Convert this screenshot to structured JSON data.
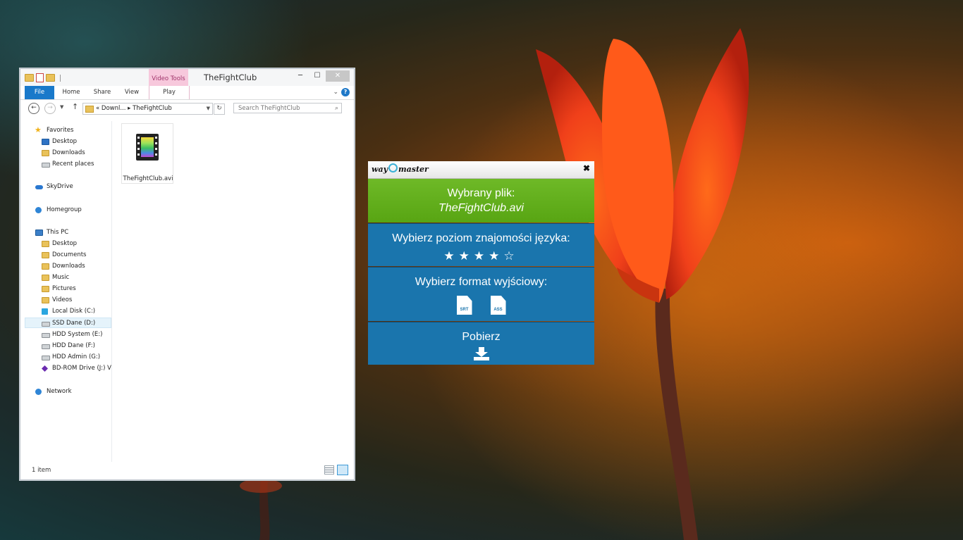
{
  "explorer": {
    "title": "TheFightClub",
    "contextual_tab": "Video Tools",
    "tabs": {
      "file": "File",
      "home": "Home",
      "share": "Share",
      "view": "View",
      "play": "Play"
    },
    "address": "«  Downl...  ▸  TheFightClub",
    "search_placeholder": "Search TheFightClub",
    "nav": {
      "favorites": "Favorites",
      "desktop": "Desktop",
      "downloads": "Downloads",
      "recent": "Recent places",
      "skydrive": "SkyDrive",
      "homegroup": "Homegroup",
      "this_pc": "This PC",
      "pc_desktop": "Desktop",
      "documents": "Documents",
      "pc_downloads": "Downloads",
      "music": "Music",
      "pictures": "Pictures",
      "videos": "Videos",
      "local_disk": "Local Disk (C:)",
      "ssd": "SSD Dane (D:)",
      "hdd_system": "HDD System (E:)",
      "hdd_dane": "HDD Dane (F:)",
      "hdd_admin": "HDD Admin (G:)",
      "bd_rom": "BD-ROM Drive (J:) V",
      "network": "Network"
    },
    "file_name": "TheFightClub.avi",
    "status": "1 item"
  },
  "waymaster": {
    "logo_left": "way",
    "logo_right": "master",
    "close": "✖",
    "selected_file_label": "Wybrany plik:",
    "selected_file": "TheFightClub.avi",
    "lang_label": "Wybierz poziom znajomości języka:",
    "stars_filled": 4,
    "stars_total": 5,
    "format_label": "Wybierz format wyjściowy:",
    "formats": [
      "SRT",
      "ASS"
    ],
    "download_label": "Pobierz"
  }
}
